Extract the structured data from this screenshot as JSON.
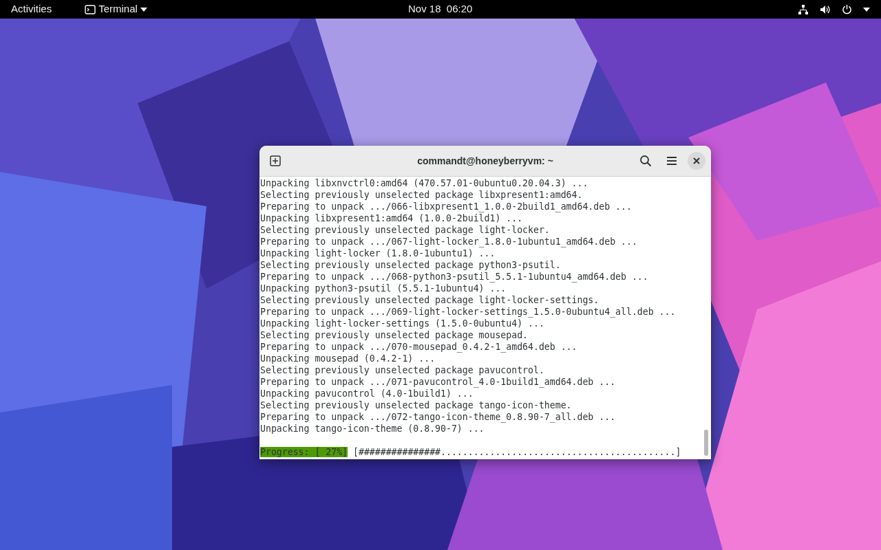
{
  "top_bar": {
    "activities": "Activities",
    "app_menu": "Terminal",
    "clock": "Nov 18  06:20"
  },
  "window": {
    "title": "commandt@honeyberryvm: ~"
  },
  "terminal": {
    "lines": [
      "Unpacking libxnvctrl0:amd64 (470.57.01-0ubuntu0.20.04.3) ...",
      "Selecting previously unselected package libxpresent1:amd64.",
      "Preparing to unpack .../066-libxpresent1_1.0.0-2build1_amd64.deb ...",
      "Unpacking libxpresent1:amd64 (1.0.0-2build1) ...",
      "Selecting previously unselected package light-locker.",
      "Preparing to unpack .../067-light-locker_1.8.0-1ubuntu1_amd64.deb ...",
      "Unpacking light-locker (1.8.0-1ubuntu1) ...",
      "Selecting previously unselected package python3-psutil.",
      "Preparing to unpack .../068-python3-psutil_5.5.1-1ubuntu4_amd64.deb ...",
      "Unpacking python3-psutil (5.5.1-1ubuntu4) ...",
      "Selecting previously unselected package light-locker-settings.",
      "Preparing to unpack .../069-light-locker-settings_1.5.0-0ubuntu4_all.deb ...",
      "Unpacking light-locker-settings (1.5.0-0ubuntu4) ...",
      "Selecting previously unselected package mousepad.",
      "Preparing to unpack .../070-mousepad_0.4.2-1_amd64.deb ...",
      "Unpacking mousepad (0.4.2-1) ...",
      "Selecting previously unselected package pavucontrol.",
      "Preparing to unpack .../071-pavucontrol_4.0-1build1_amd64.deb ...",
      "Unpacking pavucontrol (4.0-1build1) ...",
      "Selecting previously unselected package tango-icon-theme.",
      "Preparing to unpack .../072-tango-icon-theme_0.8.90-7_all.deb ...",
      "Unpacking tango-icon-theme (0.8.90-7) ..."
    ],
    "progress_label": "Progress: [ 27%]",
    "progress_bar": "[###############...........................................]"
  }
}
